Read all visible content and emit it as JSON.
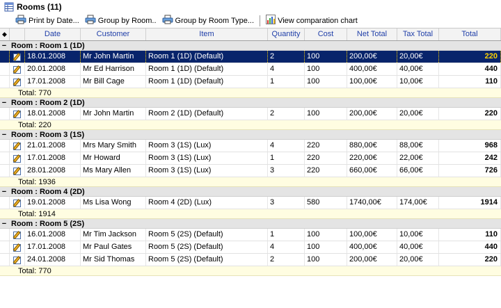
{
  "window": {
    "title": "Rooms (11)"
  },
  "toolbar": {
    "print_by_date": "Print by Date...",
    "group_by_room": "Group by Room..",
    "group_by_room_type": "Group by Room Type...",
    "view_chart": "View comparation chart"
  },
  "columns": {
    "indicator": "◆",
    "date": "Date",
    "customer": "Customer",
    "item": "Item",
    "quantity": "Quantity",
    "cost": "Cost",
    "net_total": "Net Total",
    "tax_total": "Tax Total",
    "total": "Total"
  },
  "groups": [
    {
      "title": "Room : Room 1 (1D)",
      "total_label": "Total:  770",
      "rows": [
        {
          "date": "18.01.2008",
          "customer": "Mr John Martin",
          "item": "Room 1 (1D)  (Default)",
          "qty": "2",
          "cost": "100",
          "net": "200,00€",
          "tax": "20,00€",
          "total": "220"
        },
        {
          "date": "20.01.2008",
          "customer": "Mr Ed Harrison",
          "item": "Room 1 (1D)  (Default)",
          "qty": "4",
          "cost": "100",
          "net": "400,00€",
          "tax": "40,00€",
          "total": "440"
        },
        {
          "date": "17.01.2008",
          "customer": "Mr Bill Cage",
          "item": "Room 1 (1D)  (Default)",
          "qty": "1",
          "cost": "100",
          "net": "100,00€",
          "tax": "10,00€",
          "total": "110"
        }
      ]
    },
    {
      "title": "Room : Room 2 (1D)",
      "total_label": "Total:  220",
      "rows": [
        {
          "date": "18.01.2008",
          "customer": "Mr John Martin",
          "item": "Room 2 (1D)  (Default)",
          "qty": "2",
          "cost": "100",
          "net": "200,00€",
          "tax": "20,00€",
          "total": "220"
        }
      ]
    },
    {
      "title": "Room : Room 3 (1S)",
      "total_label": "Total:  1936",
      "rows": [
        {
          "date": "21.01.2008",
          "customer": "Mrs Mary Smith",
          "item": "Room 3 (1S)  (Lux)",
          "qty": "4",
          "cost": "220",
          "net": "880,00€",
          "tax": "88,00€",
          "total": "968"
        },
        {
          "date": "17.01.2008",
          "customer": "Mr Howard",
          "item": "Room 3 (1S)  (Lux)",
          "qty": "1",
          "cost": "220",
          "net": "220,00€",
          "tax": "22,00€",
          "total": "242"
        },
        {
          "date": "28.01.2008",
          "customer": "Ms Mary Allen",
          "item": "Room 3 (1S)  (Lux)",
          "qty": "3",
          "cost": "220",
          "net": "660,00€",
          "tax": "66,00€",
          "total": "726"
        }
      ]
    },
    {
      "title": "Room : Room 4 (2D)",
      "total_label": "Total:  1914",
      "rows": [
        {
          "date": "19.01.2008",
          "customer": "Ms Lisa Wong",
          "item": "Room 4 (2D)  (Lux)",
          "qty": "3",
          "cost": "580",
          "net": "1740,00€",
          "tax": "174,00€",
          "total": "1914"
        }
      ]
    },
    {
      "title": "Room : Room 5 (2S)",
      "total_label": "Total:  770",
      "rows": [
        {
          "date": "16.01.2008",
          "customer": "Mr Tim Jackson",
          "item": "Room 5 (2S)  (Default)",
          "qty": "1",
          "cost": "100",
          "net": "100,00€",
          "tax": "10,00€",
          "total": "110"
        },
        {
          "date": "17.01.2008",
          "customer": "Mr Paul Gates",
          "item": "Room 5 (2S)  (Default)",
          "qty": "4",
          "cost": "100",
          "net": "400,00€",
          "tax": "40,00€",
          "total": "440"
        },
        {
          "date": "24.01.2008",
          "customer": "Mr Sid Thomas",
          "item": "Room 5 (2S)  (Default)",
          "qty": "2",
          "cost": "100",
          "net": "200,00€",
          "tax": "20,00€",
          "total": "220"
        }
      ]
    }
  ],
  "group_expander": "−",
  "selection": {
    "group": 0,
    "row": 0
  },
  "colors": {
    "selection_bg": "#08246b",
    "selection_total": "#ffd200",
    "header_text": "#1f3ea8",
    "group_bg": "#e4e4e4",
    "footer_bg": "#fffde1"
  },
  "icons": {
    "title": "table-icon",
    "print": "printer-icon",
    "chart": "chart-icon",
    "row": "edit-icon"
  }
}
